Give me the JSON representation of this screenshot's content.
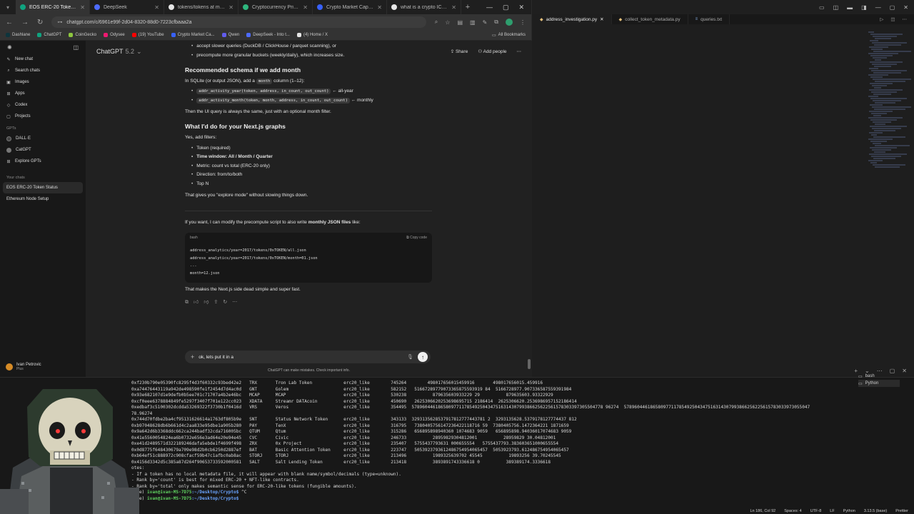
{
  "browser": {
    "tabs": [
      {
        "label": "EOS ERC-20 Token Statu",
        "color": "#10a37f",
        "active": true
      },
      {
        "label": "DeepSeek",
        "color": "#4d6bfe"
      },
      {
        "label": "tokens/tokens at maste",
        "color": "#e6e6e6"
      },
      {
        "label": "Cryptocurrency Prices, I",
        "color": "#2eb67d"
      },
      {
        "label": "Crypto Market Cap Cha",
        "color": "#3861fb"
      },
      {
        "label": "what is a crypto ICO - Go",
        "color": "#e6e6e6"
      }
    ],
    "url": "chatgpt.com/c/6961e99f-2d04-8320-88d0-7223cfbaaa2a",
    "bookmarks": [
      {
        "label": "Dashlane",
        "color": "#0e353d"
      },
      {
        "label": "ChatGPT",
        "color": "#10a37f"
      },
      {
        "label": "CoinGecko",
        "color": "#8dc63f"
      },
      {
        "label": "Odysee",
        "color": "#ef1970"
      },
      {
        "label": "(19) YouTube",
        "color": "#ff0000"
      },
      {
        "label": "Crypto Market Ca...",
        "color": "#3861fb"
      },
      {
        "label": "Qwen",
        "color": "#615ced"
      },
      {
        "label": "DeepSeek - Into t...",
        "color": "#4d6bfe"
      },
      {
        "label": "(4) Home / X",
        "color": "#e6e6e6"
      }
    ],
    "all_bookmarks": "All Bookmarks"
  },
  "sidebar": {
    "items": [
      {
        "icon": "✎",
        "label": "New chat"
      },
      {
        "icon": "⌕",
        "label": "Search chats"
      },
      {
        "icon": "▣",
        "label": "Images"
      },
      {
        "icon": "⊞",
        "label": "Apps"
      },
      {
        "icon": "◇",
        "label": "Codex"
      },
      {
        "icon": "▢",
        "label": "Projects"
      }
    ],
    "gpts_label": "GPTs",
    "gpts": [
      {
        "label": "DALL·E",
        "color": "#333"
      },
      {
        "label": "CatGPT",
        "color": "#666"
      },
      {
        "label": "Explore GPTs",
        "color": "#222"
      }
    ],
    "chats_label": "Your chats",
    "chats": [
      "EOS ERC-20 Token Status",
      "Ethereum Node Setup"
    ],
    "user": {
      "name": "Ivan Petrovic",
      "plan": "Plus"
    }
  },
  "topbar": {
    "model": "ChatGPT",
    "version": "5.2",
    "share": "Share",
    "add_people": "Add people"
  },
  "message": {
    "bullet_a": "accept slower queries (DuckDB / ClickHouse / parquet scanning), or",
    "bullet_b": "precompute more granular buckets (weekly/daily), which increases size.",
    "h_schema": "Recommended schema if we add month",
    "p_schema_a": "In SQLite (or output JSON), add a",
    "p_schema_code": "month",
    "p_schema_b": "column (1–12):",
    "code_year": "addr_activity_year(token, address, in_count, out_count)",
    "note_year": "← all-year",
    "code_month": "addr_activity_month(token, month, address, in_count, out_count)",
    "note_month": "← monthly",
    "p_ui": "Then the UI query is always the same, just with an optional month filter.",
    "h_next": "What I'd do for your Next.js graphs",
    "p_filters": "Yes, add filters:",
    "filters": [
      {
        "text": "Token (required)",
        "bold": false
      },
      {
        "text": "Time window: All / Month / Quarter",
        "bold": true
      },
      {
        "text": "Metric: count vs total (ERC-20 only)",
        "bold": false
      },
      {
        "text": "Direction: from/to/both",
        "bold": false
      },
      {
        "text": "Top N",
        "bold": false
      }
    ],
    "p_explore": "That gives you \"explore mode\" without slowing things down.",
    "p_modify_a": "If you want, I can modify the precompute script to also write",
    "p_modify_b": "monthly JSON files",
    "p_modify_c": "like:",
    "codeblock": {
      "lang": "bash",
      "copy": "Copy code",
      "lines": [
        "address_analytics/year=2017/tokens/0xTOKEN/all.json",
        "address_analytics/year=2017/tokens/0xTOKEN/month=01.json",
        "...",
        "month=12.json"
      ]
    },
    "p_final": "That makes the Next.js side dead simple and super fast."
  },
  "composer": {
    "text": "ok, lets put it in a",
    "disclaimer": "ChatGPT can make mistakes. Check important info."
  },
  "vscode": {
    "tabs": [
      {
        "label": "address_investigation.py",
        "kind": "py",
        "active": true
      },
      {
        "label": "collect_token_metadata.py",
        "kind": "py"
      },
      {
        "label": "queries.txt",
        "kind": "txt"
      }
    ]
  },
  "terminal": {
    "rows": [
      "0xf230b790e05390fc8295f4d3f60332c93bed42e2   TRX       Tron Lab Token            erc20_like        745264        498017656015459916       498017656015.459916",
      "0xa74476443119a942de498590fe1f2454d7d4ac0d   GNT       Golem                     erc20_like        582152   51667289779073365875593919 84  5166728977.907336587559391984",
      "0x93e682107d1e9defb0b5ee701c71707a4b2e46bc   MCAP      MCAP                      erc20_like        530238          879635603933229 29          879635603.93322929",
      "0xcf0eee6378884849fe5297f3407f701e122cc023   XDATA     Streamr DATAcoin          erc20_like        450690   2625306620253698695715 2186414  2625306620.2536986957152186414",
      "0xedbaf3c5100302dcdda53269322f3730b1f0416d   VRS       Veros                     erc20_like        354495  5789604461865809771178549250434751631430799386625622561578303397305504778 96274  57896044618658097711785492504347516314307993866256225615783033973055047",
      "78.96274",
      "0x744d70fdbe2ba4cf95131626614a1763df805b9e   SNT       Status Network Token      erc20_like        343133  3293135628537917812777443781 2  3293135628.5379178127774437 812",
      "0xb97048628db6b661d4c2aa833e95dbe1a905b280   PAY       TenX                      erc20_like        316795   7380405756147236422118716 59  7380405756.1472364221 1871659",
      "0x9a642d6b3368ddc662ca244badf32cda716005bc   QTUM      Qtum                      erc20_like        315286   656895898940360 1074683 9059   656895898.94036017074683 9059",
      "0x41e5560054824ea6b0732e656e3ad64e20e94e45   CVC       Civic                     erc20_like        246733          28959829304812001          28959829 30.04812001",
      "0xe41d2489571d322189246dafa5ebde1f4699f498   ZRX       0x Project                erc20_like        235407   5755437793631 000655554   5755437793.383603651000655554",
      "0x0d8775f648430679a709e98d2b0cb6250d2887ef   BAT       Basic Attention Token     erc20_like        223747   5053923793612486754954065457  5053923793.612486754954065457",
      "0xb64ef51c888972c908cfacf59b47c1afbc0ab8ac   STORJ     STORJ                     erc20_like        213496          1989325639702 45545          19893256 39.70245545",
      "0x4156d3342d5c385a87d264f90653733592000581   SALT      Salt Lending Token        erc20_like        213418          3893891743336618 0          389389174.3336618"
    ],
    "notes_title": "otes:",
    "notes": [
      "- If a token has no local metadata file, it will appear with blank name/symbol/decimals (type=unknown).",
      "- Rank by='count' is best for mixed ERC-20 + NFT-like contracts.",
      "- Rank by='total' only makes semantic sense for ERC-20-like tokens (fungible amounts)."
    ],
    "prompt_user": "ivan@ivan-MS-7D75",
    "prompt_path": ":~/Desktop/Crypto$",
    "cmd1": " ^C",
    "cmd2": " ",
    "env": "base)",
    "side_tabs": [
      "bash",
      "Python"
    ]
  },
  "statusbar": {
    "ln_col": "Ln 186, Col 92",
    "spaces": "Spaces: 4",
    "enc": "UTF-8",
    "eol": "LF",
    "lang": "Python",
    "ver": "3.13.5 (base)",
    "prettier": "Prettier"
  }
}
